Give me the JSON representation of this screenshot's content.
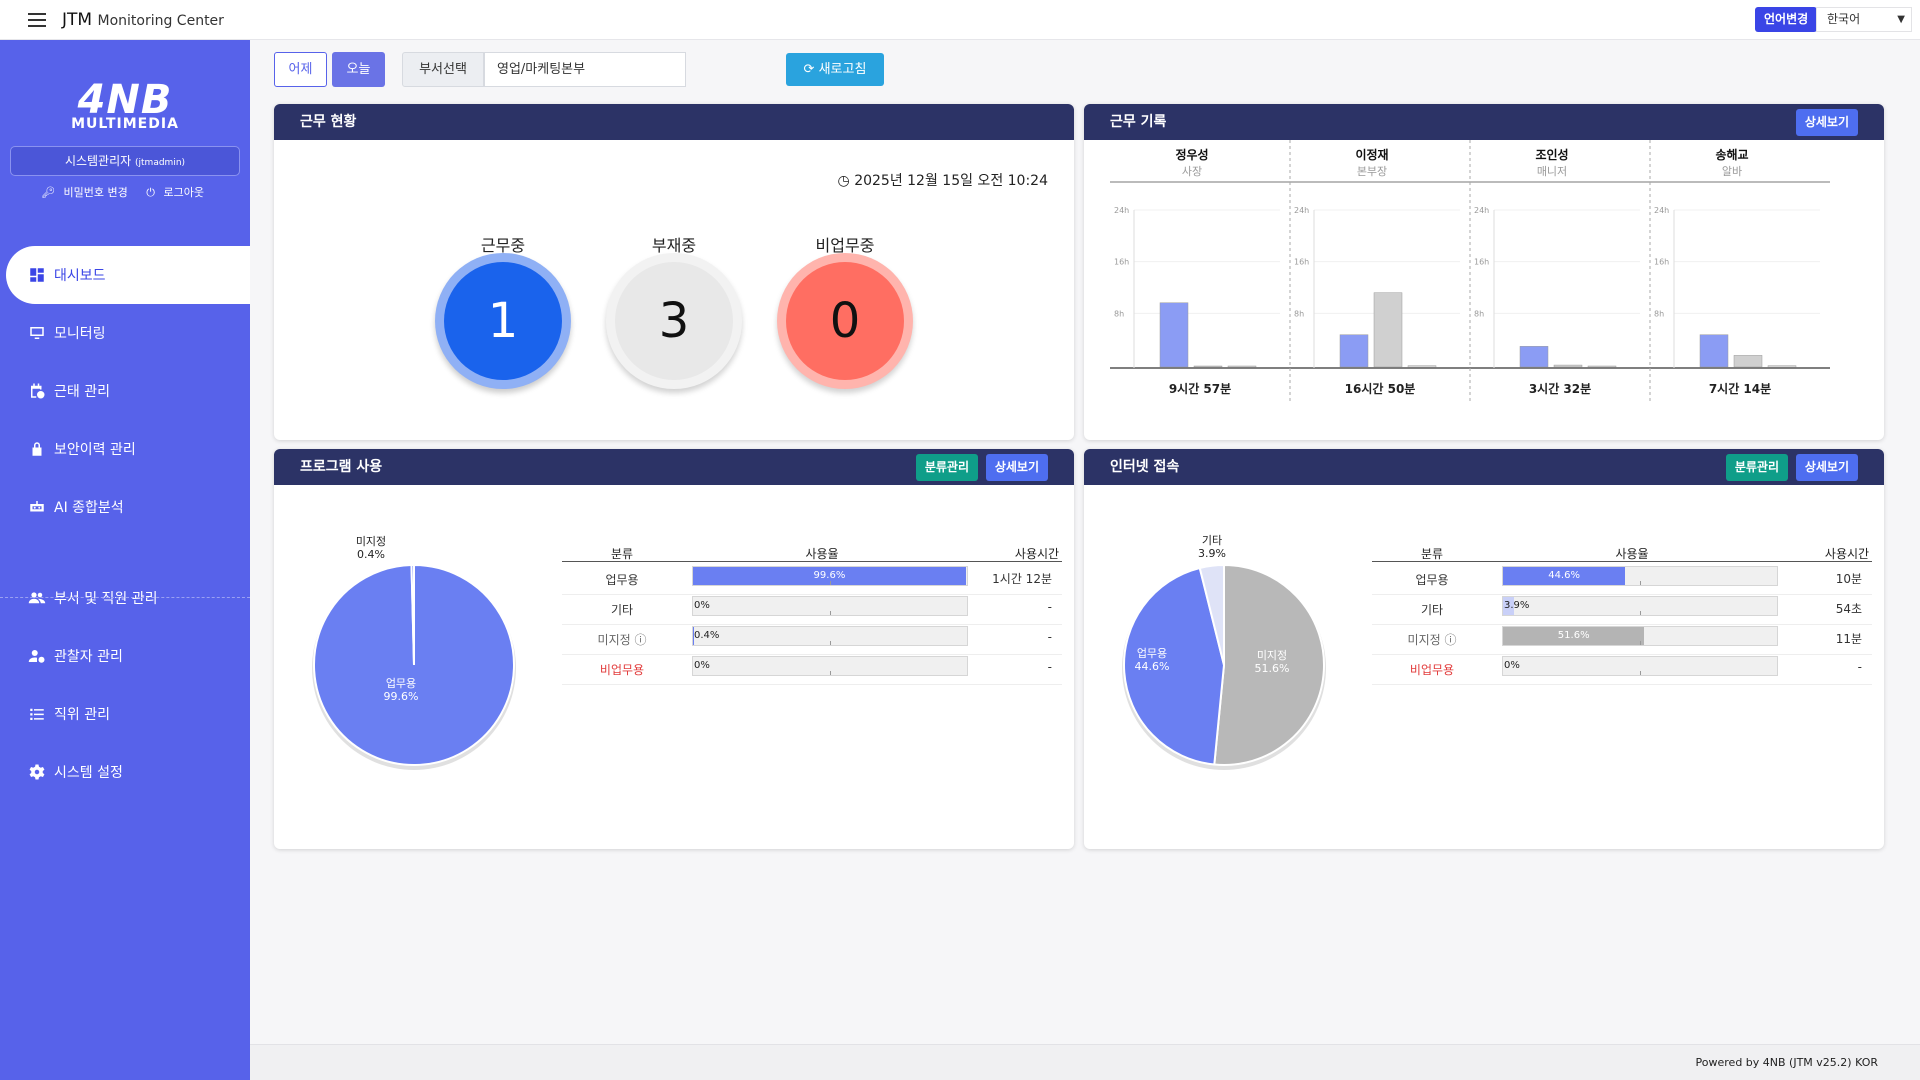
{
  "header": {
    "title": "JTM",
    "subtitle": "Monitoring Center",
    "lang_button": "언어변경",
    "lang_value": "한국어"
  },
  "sidebar": {
    "logo_main": "4NB",
    "logo_sub": "MULTIMEDIA",
    "user": "시스템관리자",
    "user_id": "(jtmadmin)",
    "change_password": "비밀번호 변경",
    "logout": "로그아웃",
    "items": [
      {
        "label": "대시보드",
        "icon": "dashboard-icon",
        "active": true
      },
      {
        "label": "모니터링",
        "icon": "monitor-icon"
      },
      {
        "label": "근태 관리",
        "icon": "calendar-clock-icon"
      },
      {
        "label": "보안이력 관리",
        "icon": "lock-icon"
      },
      {
        "label": "AI 종합분석",
        "icon": "ai-bot-icon"
      },
      {
        "label": "부서 및 직원 관리",
        "icon": "people-icon"
      },
      {
        "label": "관찰자 관리",
        "icon": "user-gear-icon"
      },
      {
        "label": "직위 관리",
        "icon": "list-icon"
      },
      {
        "label": "시스템 설정",
        "icon": "gear-icon"
      }
    ]
  },
  "filters": {
    "yesterday": "어제",
    "today": "오늘",
    "dept_label": "부서선택",
    "dept_value": "영업/마케팅본부",
    "refresh": "새로고침"
  },
  "work_status": {
    "title": "근무 현황",
    "datetime": "2025년 12월 15일 오전 10:24",
    "labels": [
      "근무중",
      "부재중",
      "비업무중"
    ],
    "values": [
      "1",
      "3",
      "0"
    ]
  },
  "work_records": {
    "title": "근무 기록",
    "detail_button": "상세보기",
    "axis_ticks": [
      "24h",
      "16h",
      "8h"
    ],
    "employees": [
      {
        "name": "정우성",
        "position": "사장",
        "total": "9시간 57분",
        "hours": [
          9.95,
          0.1,
          0.1
        ]
      },
      {
        "name": "이정재",
        "position": "본부장",
        "total": "16시간 50분",
        "hours": [
          5.0,
          11.5,
          0.2
        ]
      },
      {
        "name": "조인성",
        "position": "매니저",
        "total": "3시간 32분",
        "hours": [
          3.2,
          0.3,
          0.1
        ]
      },
      {
        "name": "송해교",
        "position": "알바",
        "total": "7시간 14분",
        "hours": [
          5.0,
          1.8,
          0.2
        ]
      }
    ]
  },
  "program_usage": {
    "title": "프로그램 사용",
    "manage_button": "분류관리",
    "detail_button": "상세보기",
    "columns": [
      "분류",
      "사용율",
      "사용시간"
    ],
    "rows": [
      {
        "category": "업무용",
        "rate_label": "99.6%",
        "rate": 99.6,
        "time": "1시간 12분",
        "color": "#6a7ff2"
      },
      {
        "category": "기타",
        "rate_label": "0%",
        "rate": 0,
        "time": "-",
        "color": "#6a7ff2"
      },
      {
        "category": "미지정",
        "rate_label": "0.4%",
        "rate": 0.4,
        "time": "-",
        "color": "#6a7ff2"
      },
      {
        "category": "비업무용",
        "rate_label": "0%",
        "rate": 0,
        "time": "-",
        "color": "#6a7ff2"
      }
    ],
    "pie": [
      {
        "label": "업무용",
        "value_label": "99.6%",
        "value": 99.6,
        "color": "#6a7ff2"
      },
      {
        "label": "미지정",
        "value_label": "0.4%",
        "value": 0.4,
        "color": "#6a7ff2"
      }
    ]
  },
  "internet_access": {
    "title": "인터넷 접속",
    "manage_button": "분류관리",
    "detail_button": "상세보기",
    "columns": [
      "분류",
      "사용율",
      "사용시간"
    ],
    "rows": [
      {
        "category": "업무용",
        "rate_label": "44.6%",
        "rate": 44.6,
        "time": "10분",
        "color": "#6a7ff2"
      },
      {
        "category": "기타",
        "rate_label": "3.9%",
        "rate": 3.9,
        "time": "54초",
        "color": "#c9d0f8"
      },
      {
        "category": "미지정",
        "rate_label": "51.6%",
        "rate": 51.6,
        "time": "11분",
        "color": "#b4b4b4"
      },
      {
        "category": "비업무용",
        "rate_label": "0%",
        "rate": 0,
        "time": "-",
        "color": "#6a7ff2"
      }
    ],
    "pie": [
      {
        "label": "미지정",
        "value_label": "51.6%",
        "value": 51.6,
        "color": "#b8b8b8"
      },
      {
        "label": "업무용",
        "value_label": "44.6%",
        "value": 44.6,
        "color": "#6a7ff2"
      },
      {
        "label": "기타",
        "value_label": "3.9%",
        "value": 3.9,
        "color": "#dfe3f7"
      }
    ]
  },
  "footer": "Powered by 4NB (JTM v25.2) KOR"
}
